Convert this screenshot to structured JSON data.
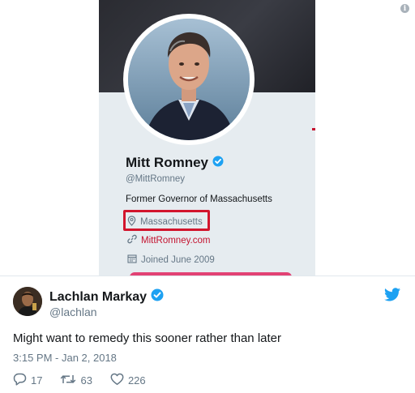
{
  "profile": {
    "name": "Mitt Romney",
    "handle": "@MittRomney",
    "bio": "Former Governor of Massachusetts",
    "location": "Massachusetts",
    "website": "MittRomney.com",
    "joined": "Joined June 2009"
  },
  "tweet": {
    "author_name": "Lachlan Markay",
    "author_handle": "@lachlan",
    "text": "Might want to remedy this sooner rather than later",
    "timestamp": "3:15 PM - Jan 2, 2018",
    "replies": "17",
    "retweets": "63",
    "likes": "226"
  },
  "icons": {
    "verified": "verified-badge-icon",
    "location": "location-pin-icon",
    "link": "link-icon",
    "calendar": "calendar-icon",
    "reply": "reply-icon",
    "retweet": "retweet-icon",
    "like": "heart-icon",
    "twitter": "twitter-bird-icon",
    "info": "info-icon"
  },
  "colors": {
    "verified_blue": "#1da1f2",
    "highlight_red": "#d2152d",
    "link_red": "#c4122f",
    "muted_text": "#657786",
    "card_background": "#e6ecf0"
  }
}
